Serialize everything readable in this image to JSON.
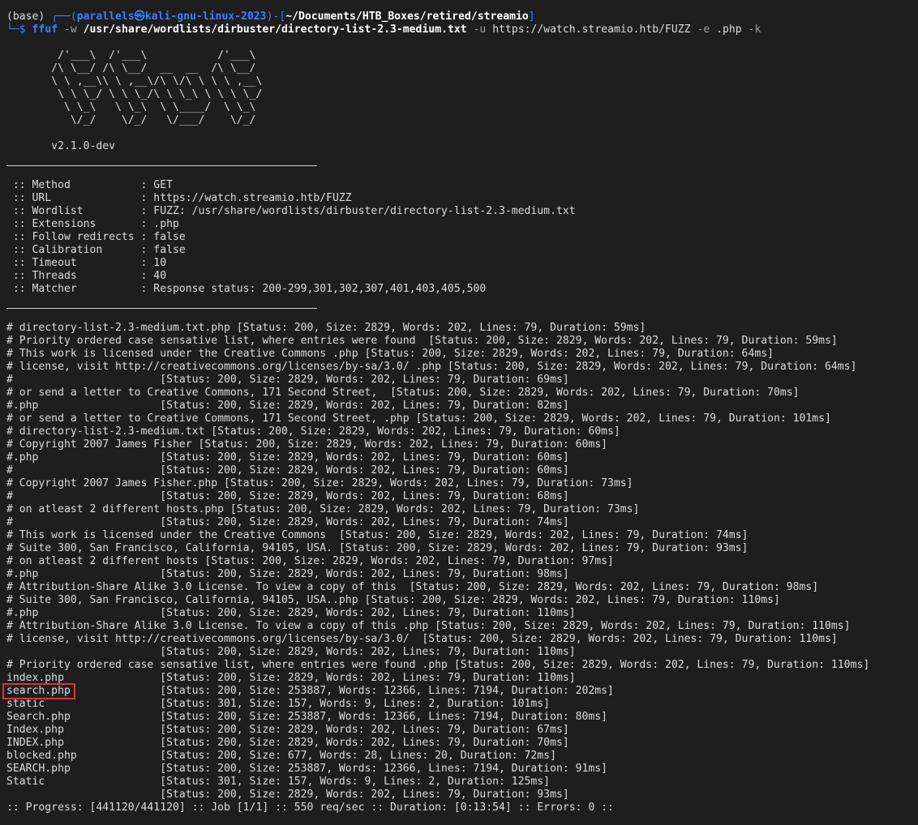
{
  "prompt": {
    "env": "(base) ",
    "corner_top": "┌──(",
    "user_host": "parallels㉿kali-gnu-linux-2023",
    "mid": ")-[",
    "cwd": "~/Documents/HTB_Boxes/retired/streamio",
    "end": "]",
    "corner_bottom": "└─$ ",
    "cmd": "ffuf",
    "flag_w": " -w ",
    "wordlist": "/usr/share/wordlists/dirbuster/directory-list-2.3-medium.txt",
    "flag_u": " -u ",
    "url": "https://watch.streamio.htb/FUZZ",
    "flag_e": " -e ",
    "ext": ".php",
    "flag_k": " -k"
  },
  "banner": [
    "        /'___\\  /'___\\           /'___\\",
    "       /\\ \\__/ /\\ \\__/  __  __  /\\ \\__/",
    "       \\ \\ ,__\\\\ \\ ,__\\/\\ \\/\\ \\ \\ \\ ,__\\",
    "        \\ \\ \\_/ \\ \\ \\_/\\ \\ \\_\\ \\ \\ \\ \\_/",
    "         \\ \\_\\   \\ \\_\\  \\ \\____/  \\ \\_\\",
    "          \\/_/    \\/_/   \\/___/    \\/_/",
    "",
    "       v2.1.0-dev"
  ],
  "config": [
    " :: Method           : GET",
    " :: URL              : https://watch.streamio.htb/FUZZ",
    " :: Wordlist         : FUZZ: /usr/share/wordlists/dirbuster/directory-list-2.3-medium.txt",
    " :: Extensions       : .php",
    " :: Follow redirects : false",
    " :: Calibration      : false",
    " :: Timeout          : 10",
    " :: Threads          : 40",
    " :: Matcher          : Response status: 200-299,301,302,307,401,403,405,500"
  ],
  "results": [
    "# directory-list-2.3-medium.txt.php [Status: 200, Size: 2829, Words: 202, Lines: 79, Duration: 59ms]",
    "# Priority ordered case sensative list, where entries were found  [Status: 200, Size: 2829, Words: 202, Lines: 79, Duration: 59ms]",
    "# This work is licensed under the Creative Commons .php [Status: 200, Size: 2829, Words: 202, Lines: 79, Duration: 64ms]",
    "# license, visit http://creativecommons.org/licenses/by-sa/3.0/ .php [Status: 200, Size: 2829, Words: 202, Lines: 79, Duration: 64ms]",
    "#                       [Status: 200, Size: 2829, Words: 202, Lines: 79, Duration: 69ms]",
    "# or send a letter to Creative Commons, 171 Second Street,  [Status: 200, Size: 2829, Words: 202, Lines: 79, Duration: 70ms]",
    "#.php                   [Status: 200, Size: 2829, Words: 202, Lines: 79, Duration: 82ms]",
    "# or send a letter to Creative Commons, 171 Second Street, .php [Status: 200, Size: 2829, Words: 202, Lines: 79, Duration: 101ms]",
    "# directory-list-2.3-medium.txt [Status: 200, Size: 2829, Words: 202, Lines: 79, Duration: 60ms]",
    "# Copyright 2007 James Fisher [Status: 200, Size: 2829, Words: 202, Lines: 79, Duration: 60ms]",
    "#.php                   [Status: 200, Size: 2829, Words: 202, Lines: 79, Duration: 60ms]",
    "#                       [Status: 200, Size: 2829, Words: 202, Lines: 79, Duration: 60ms]",
    "# Copyright 2007 James Fisher.php [Status: 200, Size: 2829, Words: 202, Lines: 79, Duration: 73ms]",
    "#                       [Status: 200, Size: 2829, Words: 202, Lines: 79, Duration: 68ms]",
    "# on atleast 2 different hosts.php [Status: 200, Size: 2829, Words: 202, Lines: 79, Duration: 73ms]",
    "#                       [Status: 200, Size: 2829, Words: 202, Lines: 79, Duration: 74ms]",
    "# This work is licensed under the Creative Commons  [Status: 200, Size: 2829, Words: 202, Lines: 79, Duration: 74ms]",
    "# Suite 300, San Francisco, California, 94105, USA. [Status: 200, Size: 2829, Words: 202, Lines: 79, Duration: 93ms]",
    "# on atleast 2 different hosts [Status: 200, Size: 2829, Words: 202, Lines: 79, Duration: 97ms]",
    "#.php                   [Status: 200, Size: 2829, Words: 202, Lines: 79, Duration: 98ms]",
    "# Attribution-Share Alike 3.0 License. To view a copy of this  [Status: 200, Size: 2829, Words: 202, Lines: 79, Duration: 98ms]",
    "# Suite 300, San Francisco, California, 94105, USA..php [Status: 200, Size: 2829, Words: 202, Lines: 79, Duration: 110ms]",
    "#.php                   [Status: 200, Size: 2829, Words: 202, Lines: 79, Duration: 110ms]",
    "# Attribution-Share Alike 3.0 License. To view a copy of this .php [Status: 200, Size: 2829, Words: 202, Lines: 79, Duration: 110ms]",
    "# license, visit http://creativecommons.org/licenses/by-sa/3.0/  [Status: 200, Size: 2829, Words: 202, Lines: 79, Duration: 110ms]",
    "                        [Status: 200, Size: 2829, Words: 202, Lines: 79, Duration: 110ms]",
    "# Priority ordered case sensative list, where entries were found .php [Status: 200, Size: 2829, Words: 202, Lines: 79, Duration: 110ms]",
    "index.php               [Status: 200, Size: 2829, Words: 202, Lines: 79, Duration: 110ms]",
    "search.php              [Status: 200, Size: 253887, Words: 12366, Lines: 7194, Duration: 202ms]",
    "static                  [Status: 301, Size: 157, Words: 9, Lines: 2, Duration: 101ms]",
    "Search.php              [Status: 200, Size: 253887, Words: 12366, Lines: 7194, Duration: 80ms]",
    "Index.php               [Status: 200, Size: 2829, Words: 202, Lines: 79, Duration: 67ms]",
    "INDEX.php               [Status: 200, Size: 2829, Words: 202, Lines: 79, Duration: 70ms]",
    "blocked.php             [Status: 200, Size: 677, Words: 28, Lines: 20, Duration: 72ms]",
    "SEARCH.php              [Status: 200, Size: 253887, Words: 12366, Lines: 7194, Duration: 91ms]",
    "Static                  [Status: 301, Size: 157, Words: 9, Lines: 2, Duration: 125ms]",
    "                        [Status: 200, Size: 2829, Words: 202, Lines: 79, Duration: 93ms]"
  ],
  "progress": ":: Progress: [441120/441120] :: Job [1/1] :: 550 req/sec :: Duration: [0:13:54] :: Errors: 0 ::",
  "highlight_color": "#e0313b",
  "prompt_color": "#3d7fff"
}
